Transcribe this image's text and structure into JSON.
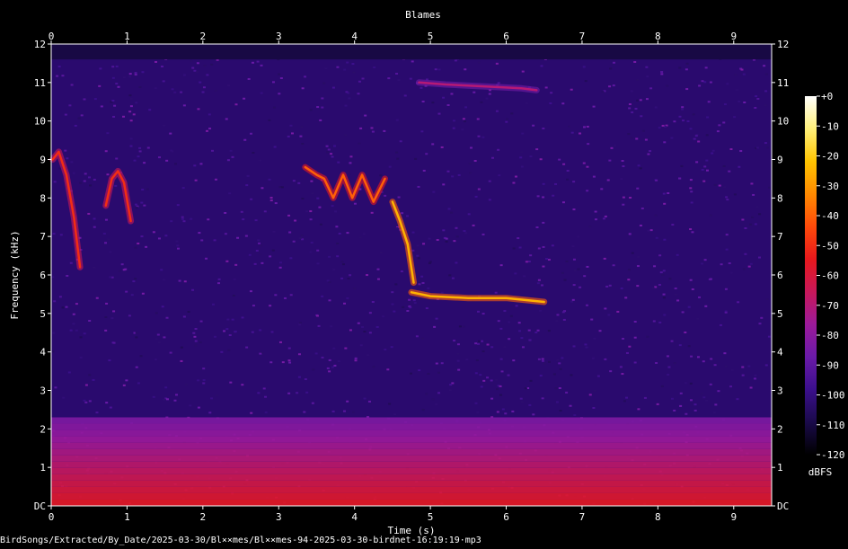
{
  "chart_data": {
    "type": "heatmap",
    "title": "Blames",
    "xlabel": "Time (s)",
    "ylabel": "Frequency (kHz)",
    "xlim": [
      0,
      9.5
    ],
    "ylim": [
      0,
      12
    ],
    "x_ticks": [
      "0",
      "1",
      "2",
      "3",
      "4",
      "5",
      "6",
      "7",
      "8",
      "9"
    ],
    "y_ticks": [
      "DC",
      "1",
      "2",
      "3",
      "4",
      "5",
      "6",
      "7",
      "8",
      "9",
      "10",
      "11",
      "12"
    ],
    "colorbar": {
      "label": "dBFS",
      "range": [
        -120,
        0
      ],
      "ticks": [
        "+0",
        "-10",
        "-20",
        "-30",
        "-40",
        "-50",
        "-60",
        "-70",
        "-80",
        "-90",
        "-100",
        "-110",
        "-120"
      ],
      "stops": [
        "#000000",
        "#1a0a4a",
        "#3b0f8c",
        "#6a1aa8",
        "#9c1a9a",
        "#c8185a",
        "#e8181c",
        "#ff4a0a",
        "#ff8a00",
        "#ffc400",
        "#fff07a",
        "#ffffff"
      ]
    },
    "calls": [
      {
        "t": [
          0.02,
          0.1,
          0.2,
          0.3,
          0.38
        ],
        "f": [
          9.0,
          9.2,
          8.6,
          7.5,
          6.2
        ],
        "level": -50
      },
      {
        "t": [
          0.72,
          0.8,
          0.88,
          0.96,
          1.05
        ],
        "f": [
          7.8,
          8.5,
          8.7,
          8.4,
          7.4
        ],
        "level": -50
      },
      {
        "t": [
          3.35,
          3.5,
          3.6,
          3.72,
          3.85,
          3.97,
          4.1,
          4.25,
          4.4
        ],
        "f": [
          8.8,
          8.6,
          8.5,
          8.0,
          8.6,
          8.0,
          8.6,
          7.9,
          8.5
        ],
        "level": -40
      },
      {
        "t": [
          4.5,
          4.6,
          4.7,
          4.78
        ],
        "f": [
          7.9,
          7.4,
          6.8,
          5.8
        ],
        "level": -25
      },
      {
        "t": [
          4.75,
          5.0,
          5.5,
          6.0,
          6.5
        ],
        "f": [
          5.55,
          5.45,
          5.4,
          5.4,
          5.3
        ],
        "level": -25
      },
      {
        "t": [
          4.85,
          5.2,
          5.7,
          6.2,
          6.4
        ],
        "f": [
          11.0,
          10.95,
          10.9,
          10.85,
          10.8
        ],
        "level": -70
      }
    ],
    "noise_floor_dbfs": -95,
    "low_band": {
      "f_max": 2.3,
      "level": -55
    }
  },
  "footer": {
    "path": "BirdSongs/Extracted/By_Date/2025-03-30/Bl××mes/Bl××mes-94-2025-03-30-birdnet-16:19:19·mp3"
  }
}
